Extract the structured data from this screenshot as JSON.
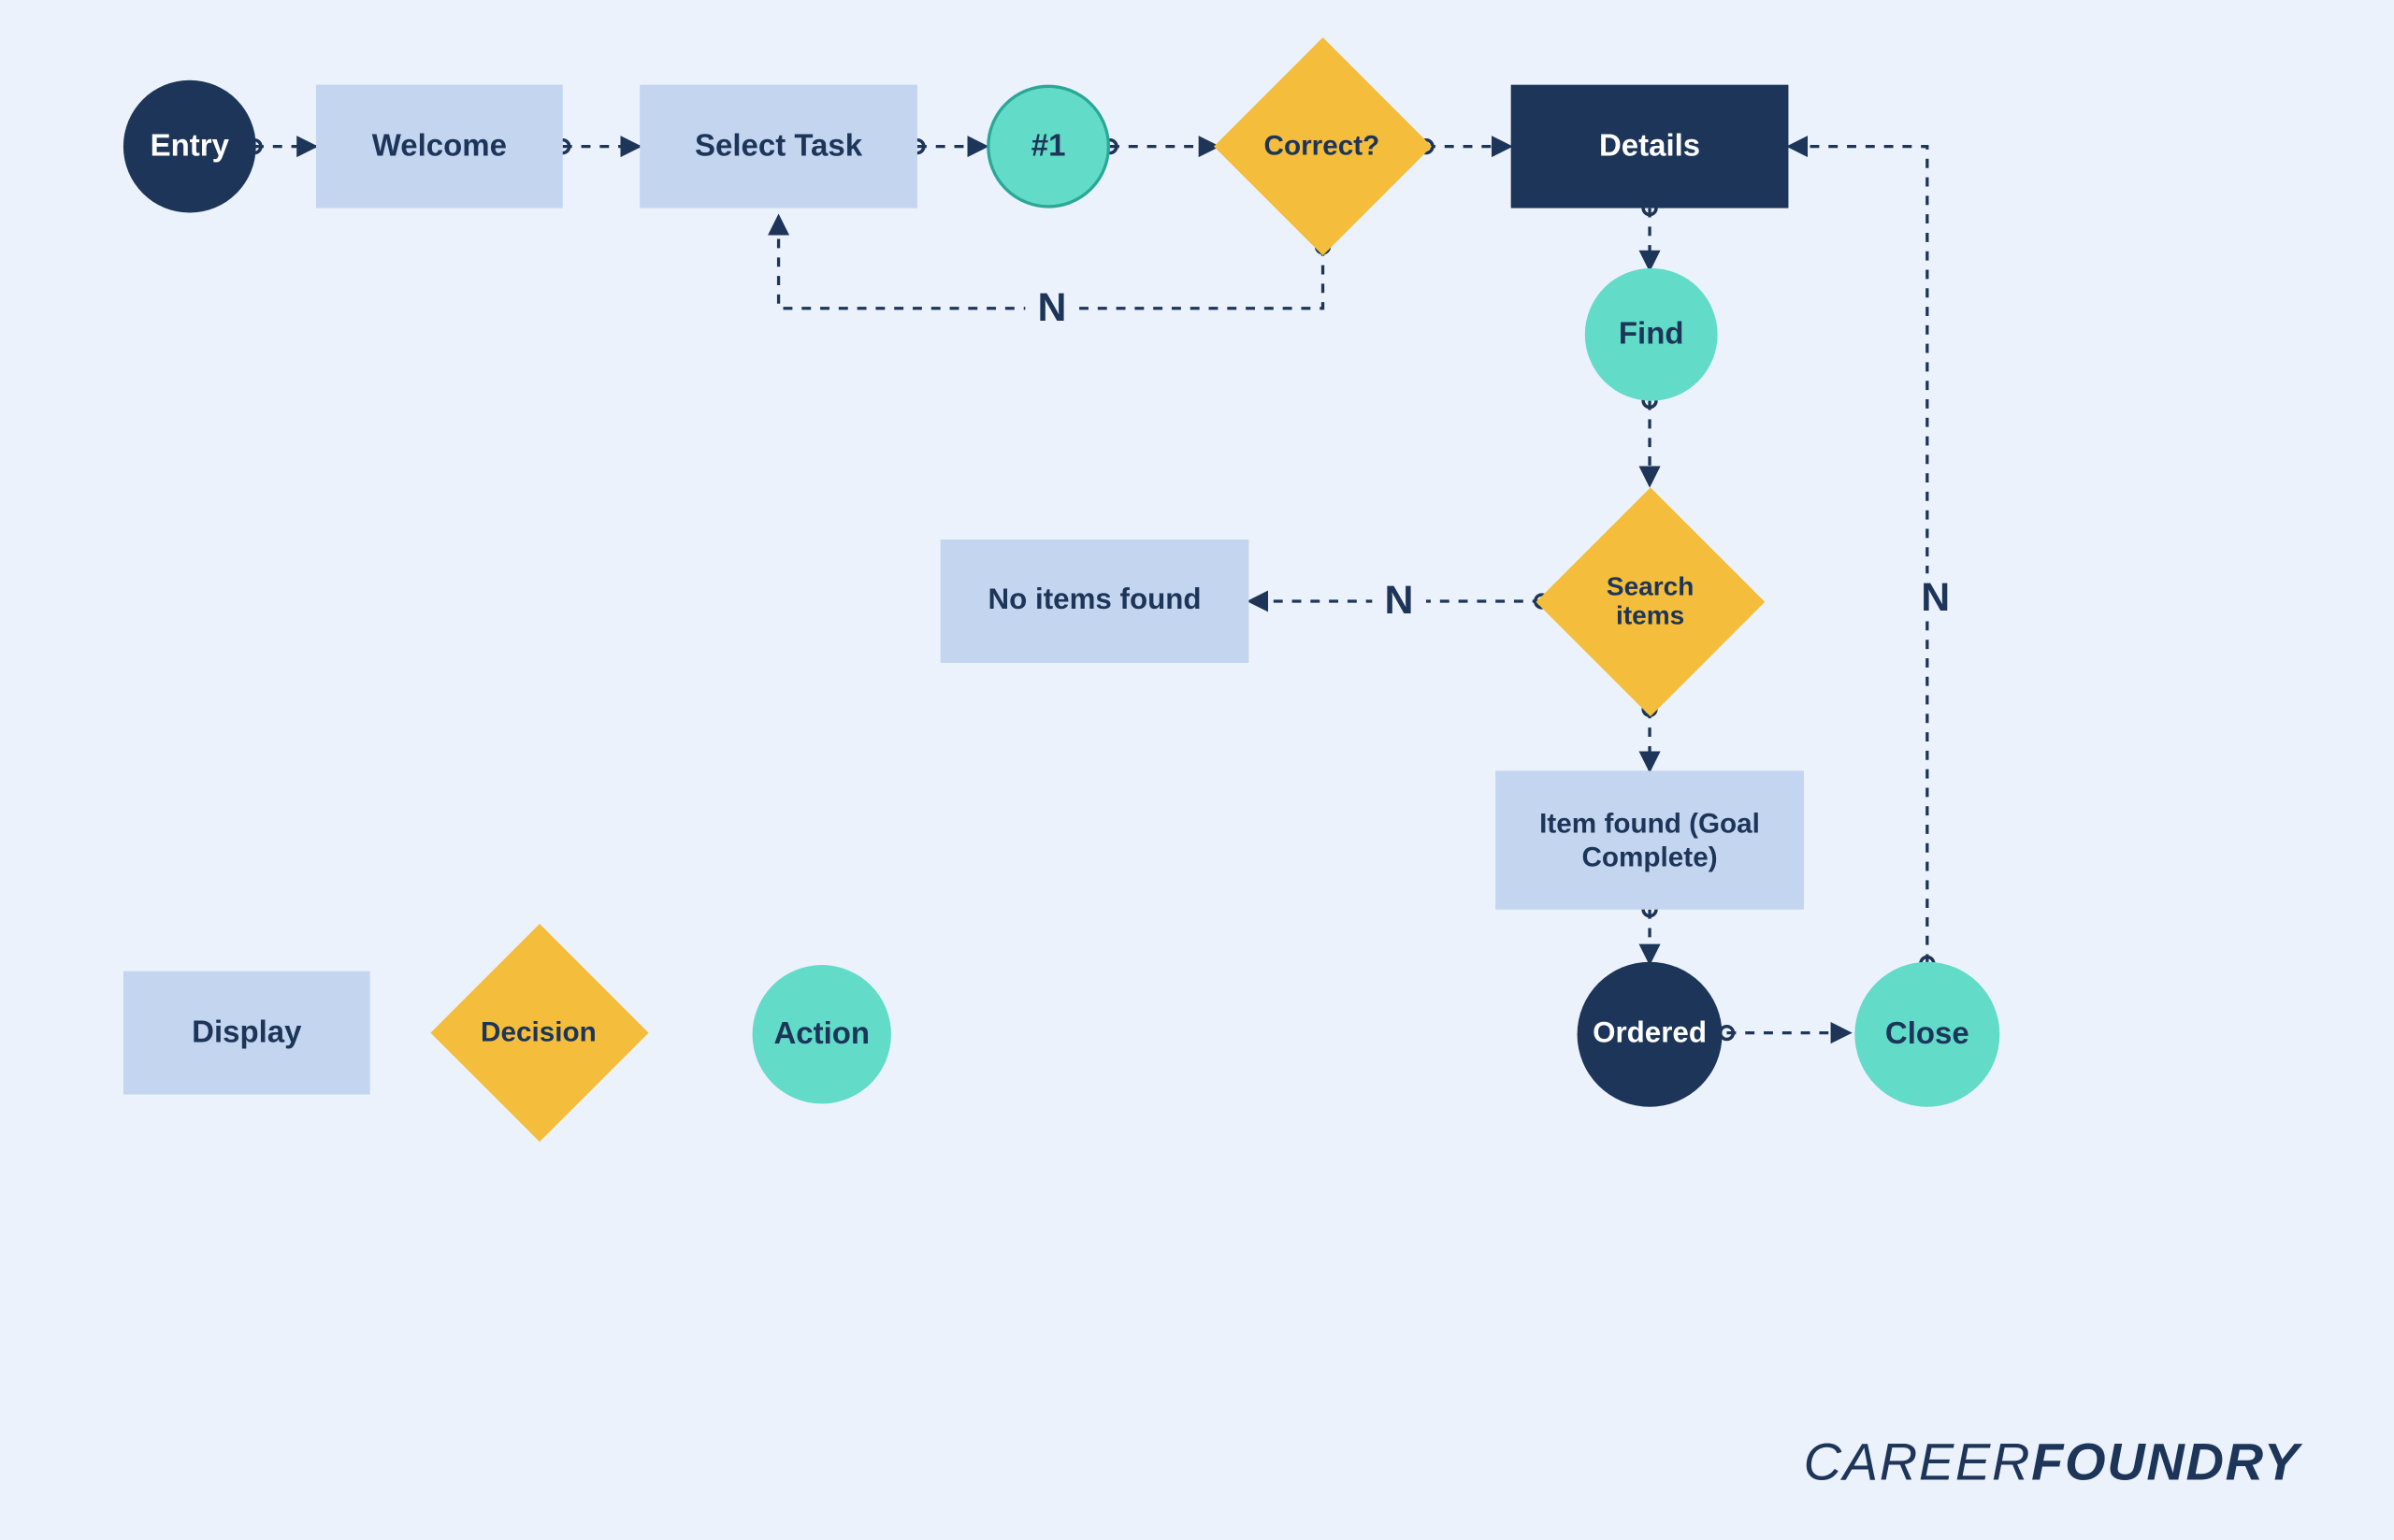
{
  "nodes": {
    "entry": {
      "label": "Entry"
    },
    "welcome": {
      "label": "Welcome"
    },
    "select_task": {
      "label": "Select Task"
    },
    "hash1": {
      "label": "#1"
    },
    "correct": {
      "label": "Correct?"
    },
    "details": {
      "label": "Details"
    },
    "find": {
      "label": "Find"
    },
    "search_items": {
      "label": "Search items"
    },
    "no_items": {
      "label": "No items found"
    },
    "item_found": {
      "label": "Item found (Goal Complete)"
    },
    "ordered": {
      "label": "Ordered"
    },
    "close": {
      "label": "Close"
    }
  },
  "legend": {
    "display": {
      "label": "Display"
    },
    "decision": {
      "label": "Decision"
    },
    "action": {
      "label": "Action"
    }
  },
  "edge_labels": {
    "correct_no": "N",
    "search_no": "N",
    "close_no": "N"
  },
  "brand": {
    "thin": "CAREER",
    "bold": "FOUNDRY"
  },
  "colors": {
    "navy": "#1c3558",
    "light_blue": "#c4d5f0",
    "teal": "#62dbc8",
    "yellow": "#f4bd3b",
    "bg": "#ecf2fb"
  }
}
